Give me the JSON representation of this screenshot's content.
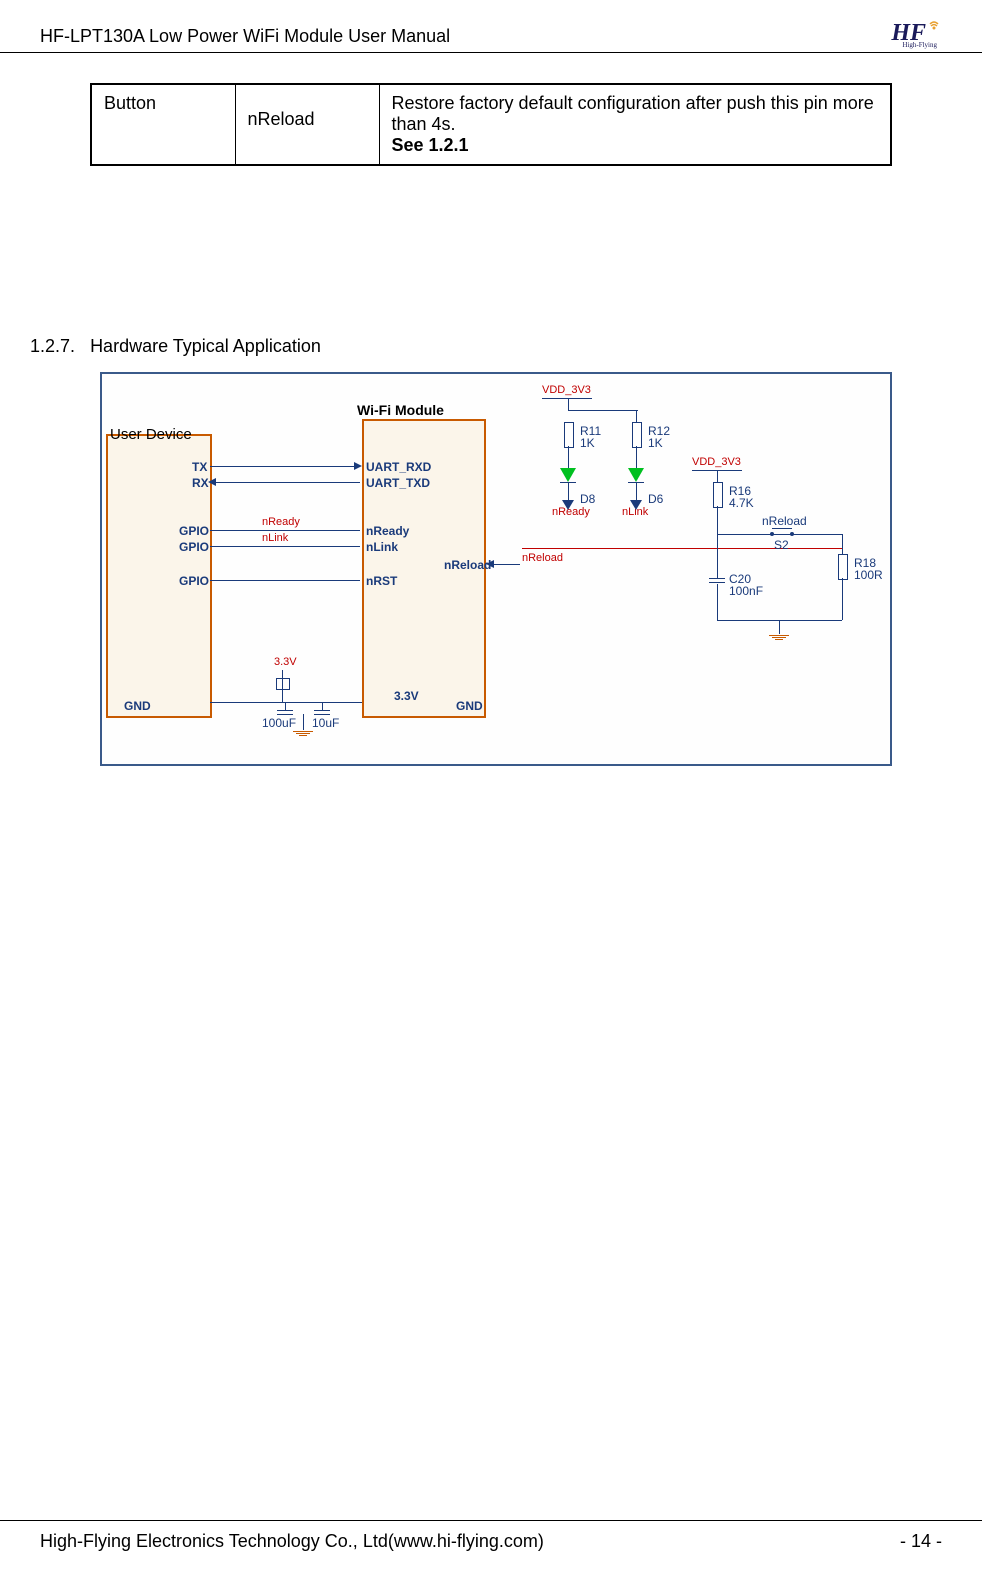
{
  "doc": {
    "title": "HF-LPT130A Low Power WiFi Module User Manual",
    "logo_text": "HF",
    "logo_sub": "High-Flying"
  },
  "table": {
    "col1": "Button",
    "col2": "nReload",
    "col3_line1": "Restore factory default configuration after push this pin more than 4s.",
    "col3_line2": "See 1.2.1"
  },
  "section": {
    "number": "1.2.7.",
    "title": "Hardware Typical Application"
  },
  "diagram": {
    "user_device": "User Device",
    "wifi_module": "Wi-Fi Module",
    "user_pins": {
      "tx": "TX",
      "rx": "RX",
      "gpio1": "GPIO",
      "gpio2": "GPIO",
      "gpio3": "GPIO",
      "gnd": "GND"
    },
    "wifi_pins": {
      "uart_rxd": "UART_RXD",
      "uart_txd": "UART_TXD",
      "nready": "nReady",
      "nlink": "nLink",
      "nrst": "nRST",
      "nreload": "nReload",
      "gnd": "GND",
      "v33": "3.3V"
    },
    "signals": {
      "nready": "nReady",
      "nlink": "nLink"
    },
    "power": {
      "vdd_3v3_1": "VDD_3V3",
      "vdd_3v3_2": "VDD_3V3",
      "v33": "3.3V",
      "v33_2": "3.3V"
    },
    "components": {
      "r11": "R11",
      "r11_val": "1K",
      "r12": "R12",
      "r12_val": "1K",
      "r16": "R16",
      "r16_val": "4.7K",
      "r18": "R18",
      "r18_val": "100R",
      "d8": "D8",
      "d8_label": "nReady",
      "d6": "D6",
      "d6_label": "nLink",
      "c20": "C20",
      "c20_val": "100nF",
      "s2": "S2",
      "nreload_label": "nReload",
      "cap1": "100uF",
      "cap2": "10uF"
    }
  },
  "footer": {
    "company": "High-Flying Electronics Technology Co., Ltd(www.hi-flying.com)",
    "page": "- 14 -"
  }
}
